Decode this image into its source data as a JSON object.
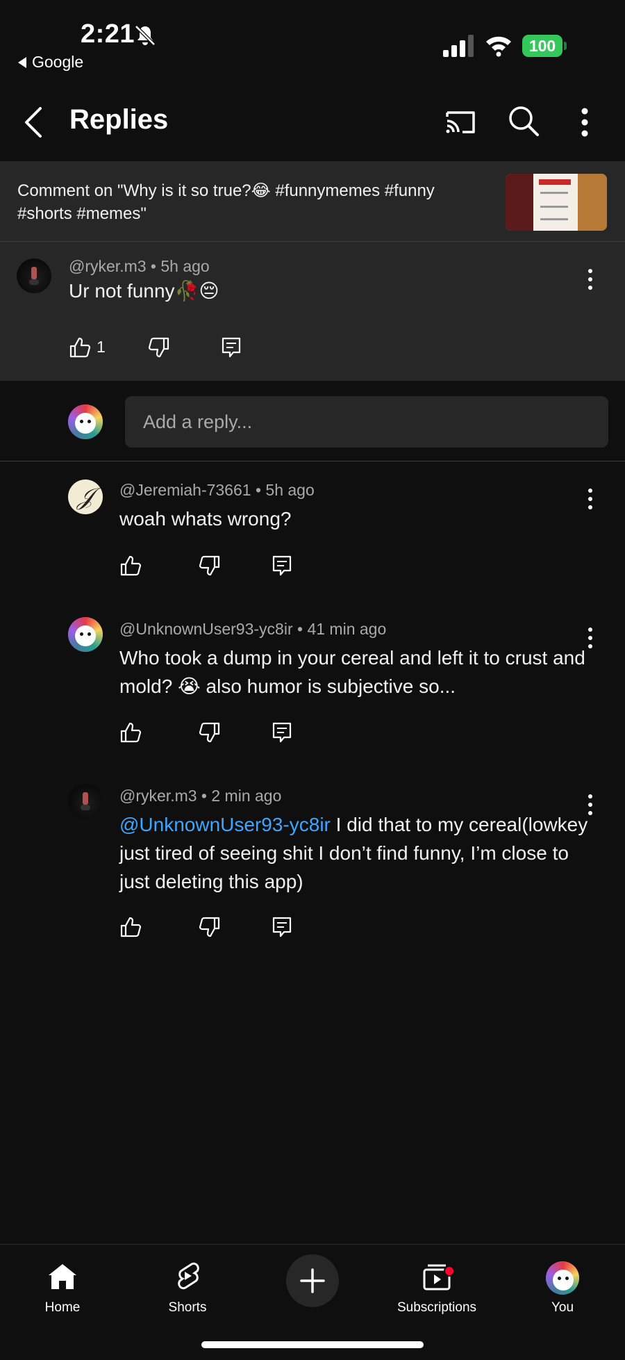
{
  "status_bar": {
    "time": "2:21",
    "back_app": "Google",
    "battery": "100"
  },
  "header": {
    "title": "Replies",
    "back_icon": "chevron-left-icon",
    "cast_icon": "cast-icon",
    "search_icon": "search-icon",
    "more_icon": "more-vert-icon"
  },
  "context": {
    "text": "Comment on \"Why is it so true?😂 #funnymemes #funny #shorts #memes\""
  },
  "parent_comment": {
    "author": "@ryker.m3",
    "time": "5h ago",
    "text": "Ur not funny🥀😔",
    "likes": "1"
  },
  "reply_box": {
    "placeholder": "Add a reply..."
  },
  "replies": [
    {
      "author": "@Jeremiah-73661",
      "time": "5h ago",
      "text": "woah whats wrong?"
    },
    {
      "author": "@UnknownUser93-yc8ir",
      "time": "41 min ago",
      "text": "Who took a dump in your cereal and left it to crust and mold? 😭 also humor is subjective so..."
    },
    {
      "author": "@ryker.m3",
      "time": "2 min ago",
      "mention": "@UnknownUser93-yc8ir",
      "text": " I did that to my cereal(lowkey just tired of seeing shit I don’t find funny, I’m close to just deleting this app)"
    }
  ],
  "separator": "•",
  "bottom_nav": {
    "items": [
      {
        "label": "Home",
        "icon": "home-icon"
      },
      {
        "label": "Shorts",
        "icon": "shorts-icon"
      },
      {
        "label": "",
        "icon": "plus-icon"
      },
      {
        "label": "Subscriptions",
        "icon": "subscriptions-icon"
      },
      {
        "label": "You",
        "icon": "avatar"
      }
    ]
  },
  "colors": {
    "background": "#0f0f0f",
    "surface": "#272727",
    "mention": "#3ea6ff",
    "battery": "#34c759",
    "notification": "#ff0033"
  }
}
